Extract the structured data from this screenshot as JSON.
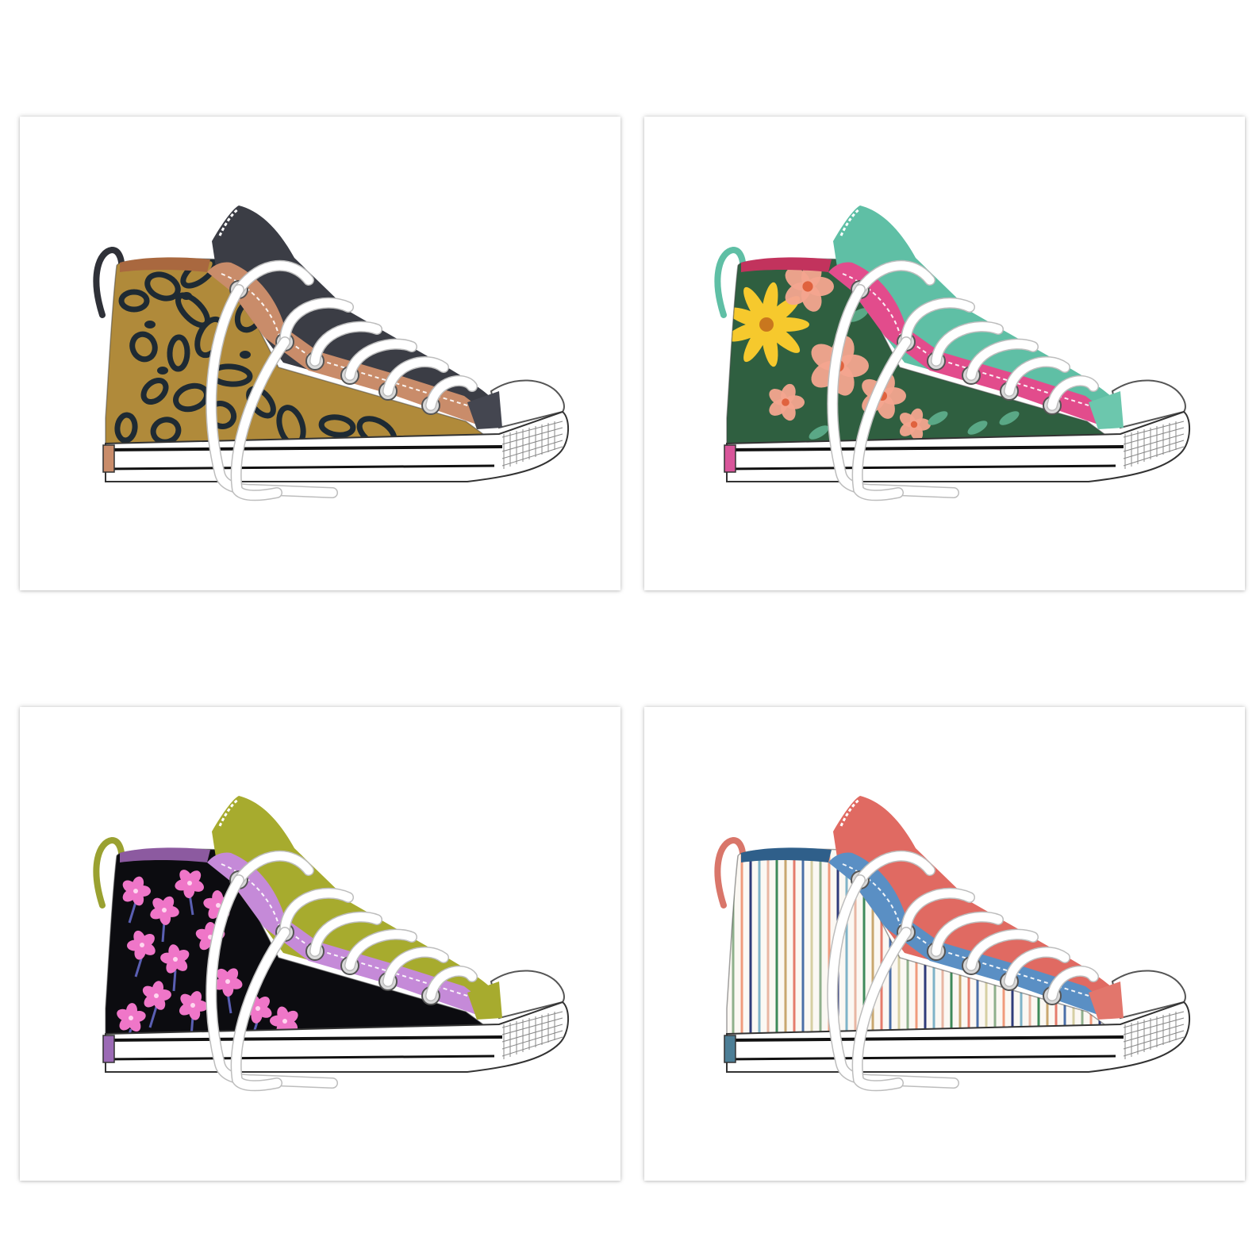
{
  "prints": [
    {
      "name": "leopard",
      "pattern": "leopard",
      "base": "#b08a3a",
      "spot": "#1e2a33",
      "tongue": "#c98c6a",
      "collar": "#a9683f",
      "heel": "#3b3d45",
      "toe_band": "#444650",
      "loop": "#2f3138",
      "tag": "#c98c6a",
      "accent": "#d9a18a"
    },
    {
      "name": "green-floral",
      "pattern": "floral-green",
      "base": "#2f5f40",
      "spot": "#f4a58f",
      "tongue": "#e24c8c",
      "collar": "#c2335d",
      "heel": "#5fbfa5",
      "toe_band": "#6cc7ad",
      "loop": "#5fbfa5",
      "tag": "#d8559a",
      "accent": "#f6c92d"
    },
    {
      "name": "pink-blossom",
      "pattern": "blossom-black",
      "base": "#0c0c10",
      "spot": "#ef76c8",
      "tongue": "#c58ad8",
      "collar": "#8c5aa0",
      "heel": "#a7ab2e",
      "toe_band": "#a7ab2e",
      "loop": "#9aa131",
      "tag": "#9b6ab5",
      "accent": "#5a5fb3"
    },
    {
      "name": "stripes",
      "pattern": "stripes",
      "base": "#fbf8f3",
      "spot": "#2a5d9a",
      "tongue": "#5a8fc4",
      "collar": "#2f5f8a",
      "heel": "#e06a62",
      "toe_band": "#e2766c",
      "loop": "#d9766a",
      "tag": "#4c7e96",
      "accent": "#e38a7c"
    }
  ]
}
